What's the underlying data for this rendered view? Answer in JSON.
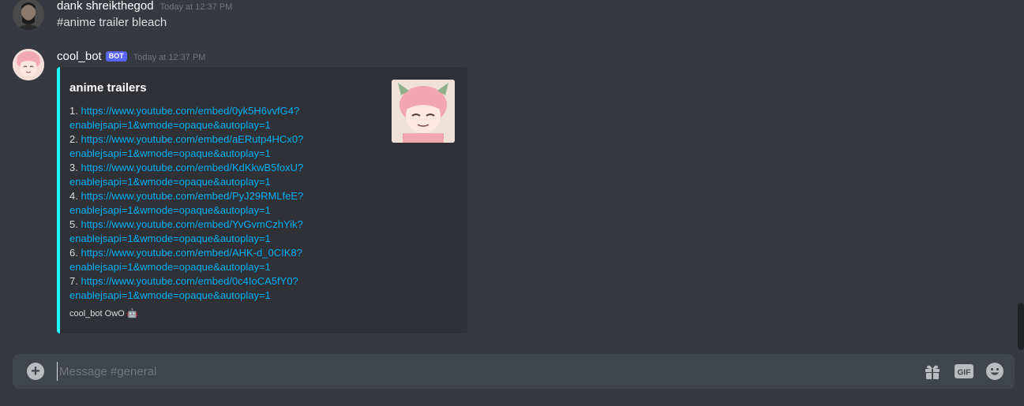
{
  "messages": [
    {
      "username": "dank shreikthegod",
      "timestamp": "Today at 12:37 PM",
      "content": "#anime trailer bleach"
    },
    {
      "username": "cool_bot",
      "bot_tag": "BOT",
      "timestamp": "Today at 12:37 PM",
      "embed": {
        "color": "#1dfcfc",
        "title": "anime trailers",
        "items": [
          {
            "num": "1.",
            "url_line1": "https://www.youtube.com/embed/0yk5H6vvfG4?",
            "url_line2": "enablejsapi=1&wmode=opaque&autoplay=1"
          },
          {
            "num": "2.",
            "url_line1": "https://www.youtube.com/embed/aERutp4HCx0?",
            "url_line2": "enablejsapi=1&wmode=opaque&autoplay=1"
          },
          {
            "num": "3.",
            "url_line1": "https://www.youtube.com/embed/KdKkwB5foxU?",
            "url_line2": "enablejsapi=1&wmode=opaque&autoplay=1"
          },
          {
            "num": "4.",
            "url_line1": "https://www.youtube.com/embed/PyJ29RMLfeE?",
            "url_line2": "enablejsapi=1&wmode=opaque&autoplay=1"
          },
          {
            "num": "5.",
            "url_line1": "https://www.youtube.com/embed/YvGvmCzhYik?",
            "url_line2": "enablejsapi=1&wmode=opaque&autoplay=1"
          },
          {
            "num": "6.",
            "url_line1": "https://www.youtube.com/embed/AHK-d_0CIK8?",
            "url_line2": "enablejsapi=1&wmode=opaque&autoplay=1"
          },
          {
            "num": "7.",
            "url_line1": "https://www.youtube.com/embed/0c4IoCA5fY0?",
            "url_line2": "enablejsapi=1&wmode=opaque&autoplay=1"
          }
        ],
        "footer": "cool_bot OwO 🤖"
      }
    }
  ],
  "composer": {
    "placeholder": "Message #general",
    "gif_label": "GIF",
    "icons": [
      "add-icon",
      "gift-icon",
      "gif-icon",
      "emoji-icon"
    ]
  },
  "colors": {
    "background": "#36393f",
    "embed_background": "#2f3136",
    "link": "#00b0f4",
    "bot_tag": "#5865f2",
    "input_background": "#40444b"
  }
}
